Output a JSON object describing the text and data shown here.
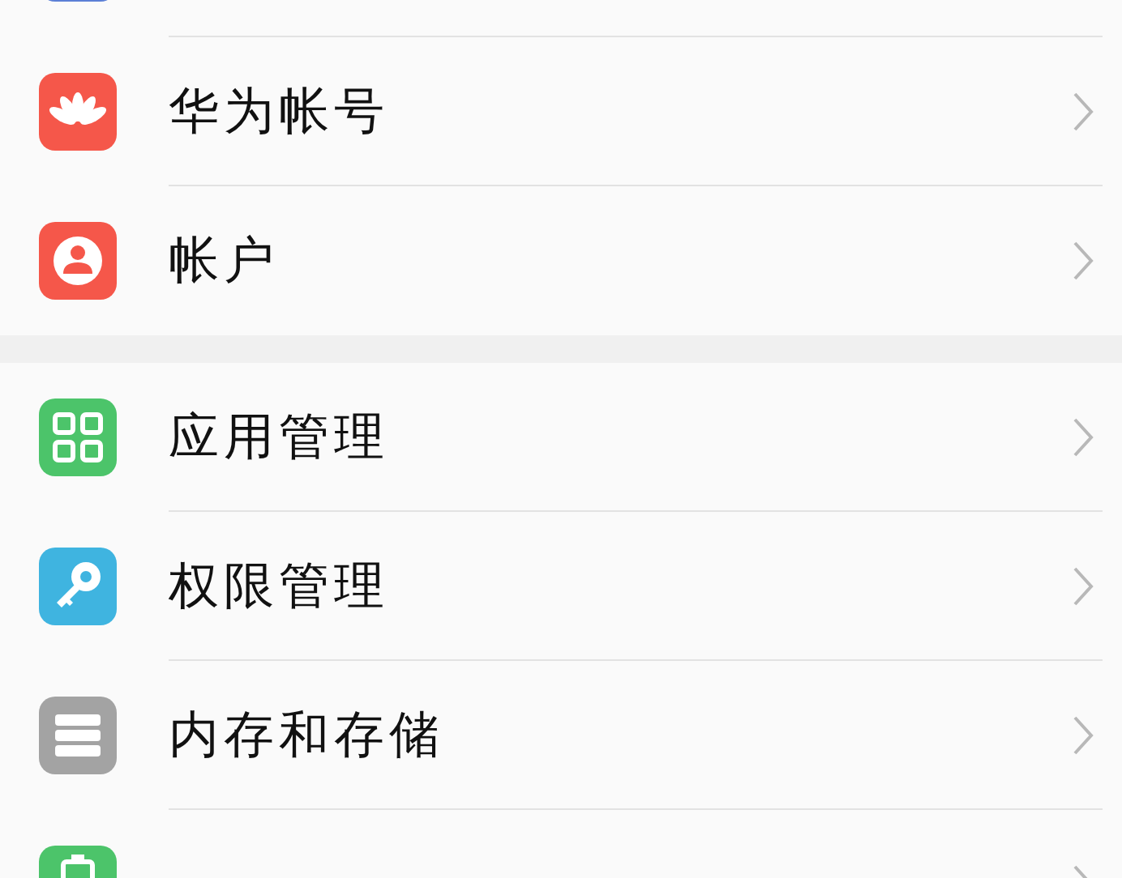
{
  "groups": [
    {
      "items": [
        {
          "kind": "app",
          "color": "#5b7fd6"
        },
        {
          "label": "华为帐号",
          "kind": "huawei",
          "color": "#f5574a"
        },
        {
          "label": "帐户",
          "kind": "account",
          "color": "#f5574a"
        }
      ]
    },
    {
      "items": [
        {
          "label": "应用管理",
          "kind": "apps",
          "color": "#4cc46a"
        },
        {
          "label": "权限管理",
          "kind": "key",
          "color": "#3fb4e0"
        },
        {
          "label": "内存和存储",
          "kind": "storage",
          "color": "#a3a3a3"
        },
        {
          "kind": "battery",
          "color": "#4cc46a"
        }
      ]
    }
  ]
}
